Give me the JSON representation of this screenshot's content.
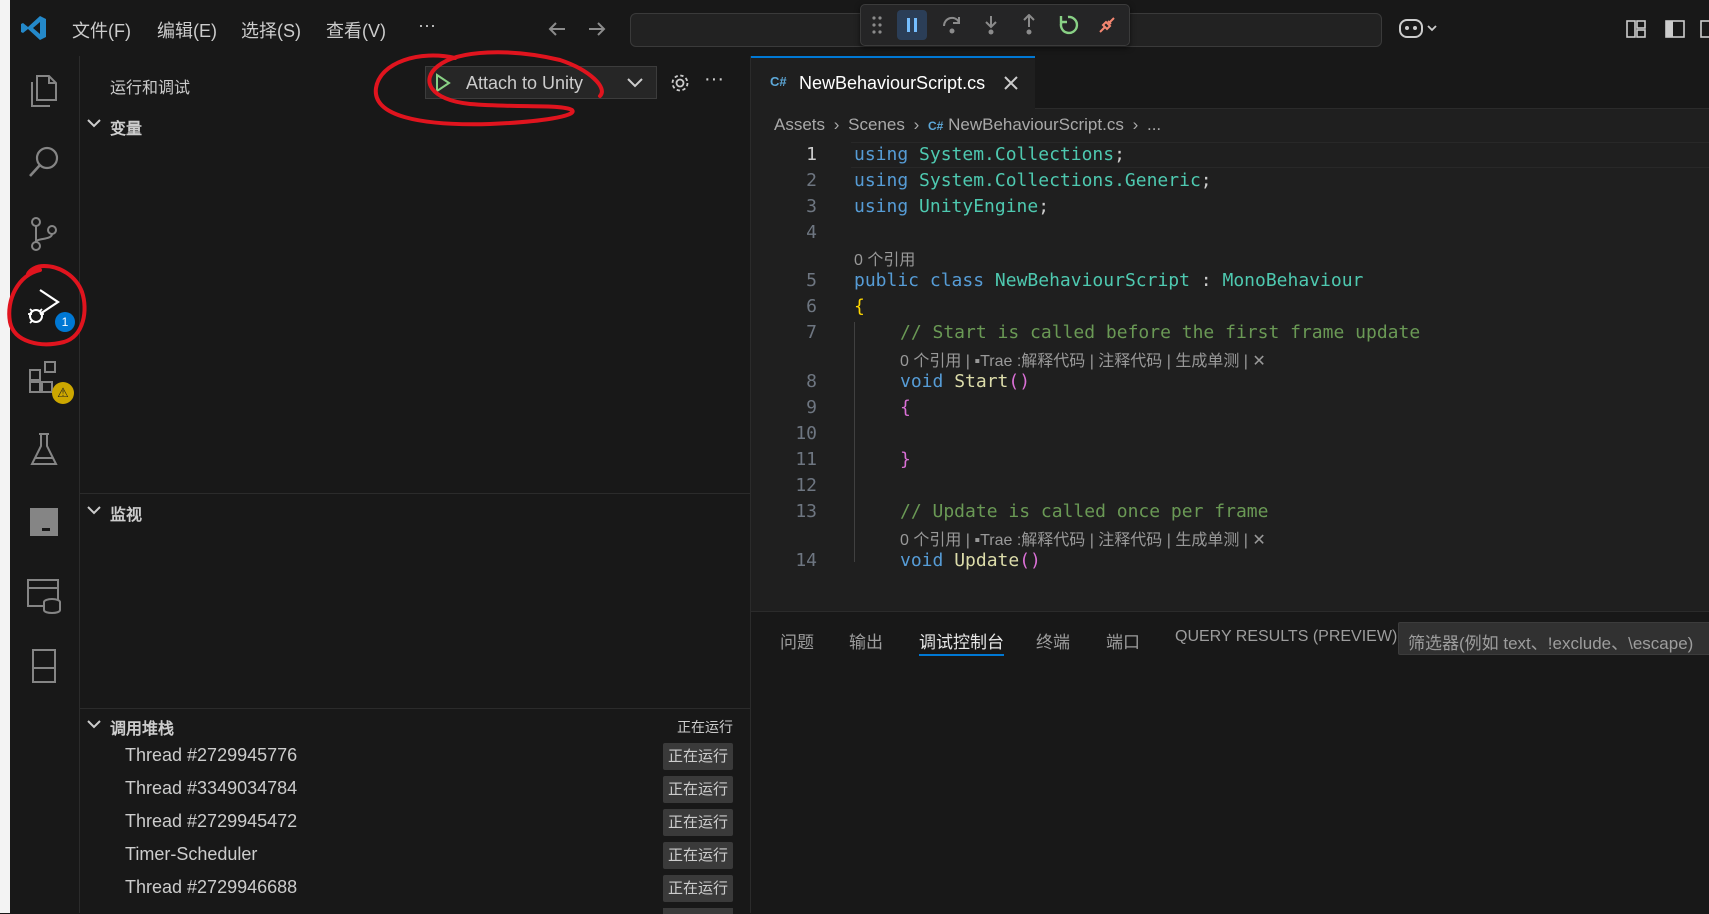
{
  "menu": {
    "file": "文件(F)",
    "edit": "编辑(E)",
    "selection": "选择(S)",
    "view": "查看(V)",
    "more": "···"
  },
  "sidebar": {
    "title": "运行和调试",
    "launch_config": "Attach to Unity",
    "variables_header": "变量",
    "watch_header": "监视",
    "callstack_header": "调用堆栈",
    "callstack_status": "正在运行",
    "threads": [
      {
        "name": "Thread #2729945776",
        "status": "正在运行"
      },
      {
        "name": "Thread #3349034784",
        "status": "正在运行"
      },
      {
        "name": "Thread #2729945472",
        "status": "正在运行"
      },
      {
        "name": "Timer-Scheduler",
        "status": "正在运行"
      },
      {
        "name": "Thread #2729946688",
        "status": "正在运行"
      }
    ]
  },
  "activity": {
    "debug_badge": "1",
    "extensions_badge": "⚠"
  },
  "editor": {
    "tab_label": "NewBehaviourScript.cs",
    "breadcrumb": {
      "assets": "Assets",
      "scenes": "Scenes",
      "file": "NewBehaviourScript.cs",
      "more": "..."
    },
    "line_numbers": [
      "1",
      "2",
      "3",
      "4",
      "5",
      "6",
      "7",
      "8",
      "9",
      "10",
      "11",
      "12",
      "13",
      "14"
    ],
    "refs_class": "0 个引用",
    "lens_start": "0 个引用 | ▪Trae :解释代码 | 注释代码 | 生成单测 | ✕",
    "lens_update": "0 个引用 | ▪Trae :解释代码 | 注释代码 | 生成单测 | ✕",
    "code": {
      "l1_kw": "using",
      "l1_ns": " System.Collections",
      "l1_end": ";",
      "l2_kw": "using",
      "l2_ns": " System.Collections.Generic",
      "l2_end": ";",
      "l3_kw": "using",
      "l3_ns": " UnityEngine",
      "l3_end": ";",
      "l5_kw1": "public",
      "l5_kw2": " class",
      "l5_name": " NewBehaviourScript",
      "l5_colon": " :",
      "l5_base": " MonoBehaviour",
      "l6_brace": "{",
      "l7_comment": "// Start is called before the first frame update",
      "l8_kw": "void",
      "l8_fn": " Start",
      "l8_paren": "()",
      "l9_brace": "{",
      "l11_brace": "}",
      "l13_comment": "// Update is called once per frame",
      "l14_kw": "void",
      "l14_fn": " Update",
      "l14_paren": "()"
    }
  },
  "panel": {
    "tabs": [
      "问题",
      "输出",
      "调试控制台",
      "终端",
      "端口",
      "QUERY RESULTS (PREVIEW)"
    ],
    "active_tab": "调试控制台",
    "filter_placeholder": "筛选器(例如 text、!exclude、\\escape)"
  },
  "colors": {
    "accent": "#0078d4",
    "annotation": "#e0141e",
    "background": "#181818",
    "editor_bg": "#1f1f1f"
  }
}
